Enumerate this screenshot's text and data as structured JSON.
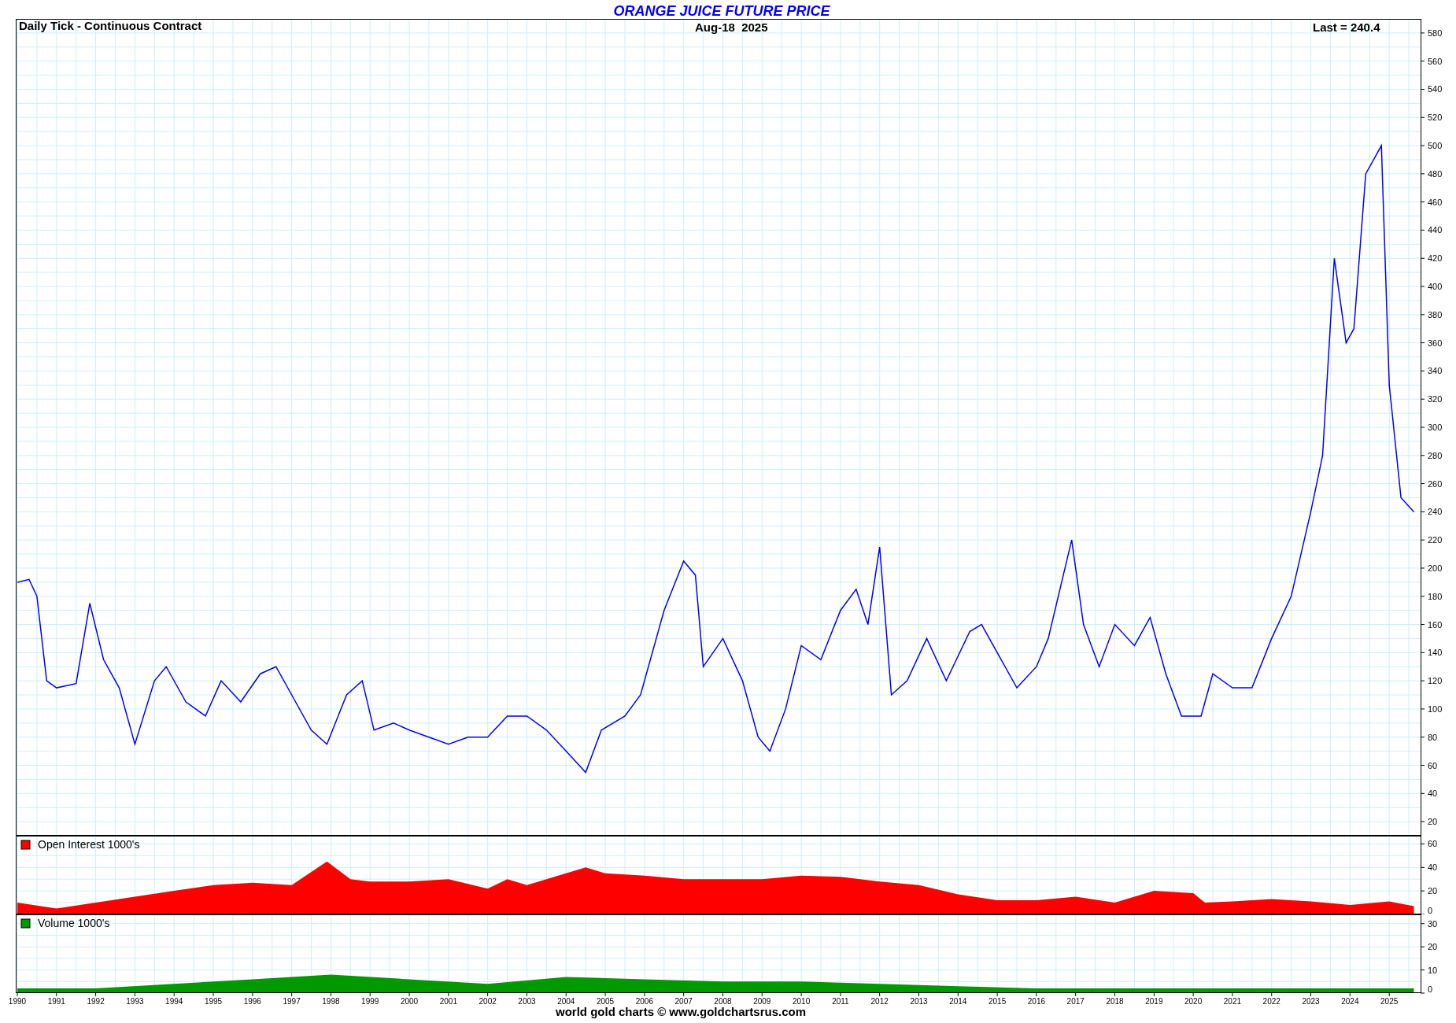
{
  "title": "ORANGE JUICE FUTURE PRICE",
  "price_panel": {
    "subtitle": "Daily Tick - Continuous Contract",
    "date": "Aug-18  2025",
    "last": "Last = 240.4",
    "chart_data": {
      "type": "line",
      "grid": true,
      "xlim": [
        1989.96,
        2025.8
      ],
      "ylim": [
        10,
        590
      ],
      "yticks": [
        20,
        40,
        60,
        80,
        100,
        120,
        140,
        160,
        180,
        200,
        220,
        240,
        260,
        280,
        300,
        320,
        340,
        360,
        380,
        400,
        420,
        440,
        460,
        480,
        500,
        520,
        540,
        560,
        580
      ],
      "x": [
        1990,
        1990.3,
        1990.5,
        1990.75,
        1991,
        1991.5,
        1991.85,
        1992.2,
        1992.6,
        1993,
        1993.5,
        1993.8,
        1994.3,
        1994.8,
        1995.2,
        1995.7,
        1996.2,
        1996.6,
        1997,
        1997.5,
        1997.9,
        1998.4,
        1998.8,
        1999.1,
        1999.6,
        2000,
        2000.5,
        2001,
        2001.5,
        2002,
        2002.5,
        2003,
        2003.5,
        2004,
        2004.5,
        2004.9,
        2005.5,
        2005.9,
        2006.5,
        2007,
        2007.3,
        2007.5,
        2008,
        2008.5,
        2008.9,
        2009.2,
        2009.6,
        2010,
        2010.5,
        2011,
        2011.4,
        2011.7,
        2012,
        2012.3,
        2012.7,
        2013.2,
        2013.7,
        2014.3,
        2014.6,
        2015,
        2015.5,
        2016,
        2016.3,
        2016.9,
        2017.2,
        2017.6,
        2018,
        2018.5,
        2018.9,
        2019.3,
        2019.7,
        2020.2,
        2020.5,
        2021,
        2021.5,
        2022,
        2022.5,
        2023,
        2023.3,
        2023.6,
        2023.9,
        2024.1,
        2024.4,
        2024.8,
        2025,
        2025.3,
        2025.63
      ],
      "series": [
        {
          "color": "#0000ff",
          "values": [
            190,
            192,
            180,
            120,
            115,
            118,
            175,
            135,
            115,
            75,
            120,
            130,
            105,
            95,
            120,
            105,
            125,
            130,
            110,
            85,
            75,
            110,
            120,
            85,
            90,
            85,
            80,
            75,
            80,
            80,
            95,
            95,
            85,
            70,
            55,
            85,
            95,
            110,
            170,
            205,
            195,
            130,
            150,
            120,
            80,
            70,
            100,
            145,
            135,
            170,
            185,
            160,
            215,
            110,
            120,
            150,
            120,
            155,
            160,
            140,
            115,
            130,
            150,
            220,
            160,
            130,
            160,
            145,
            165,
            125,
            95,
            95,
            125,
            115,
            115,
            150,
            180,
            240,
            280,
            420,
            360,
            370,
            480,
            500,
            330,
            250,
            240
          ]
        }
      ]
    }
  },
  "open_interest_panel": {
    "chart_data": {
      "type": "area",
      "grid": true,
      "xlim": [
        1989.96,
        2025.8
      ],
      "ylim": [
        0,
        67
      ],
      "yticks": [
        0,
        20,
        40,
        60
      ],
      "x": [
        1990,
        1991,
        1992,
        1993,
        1994,
        1995,
        1996,
        1997,
        1997.9,
        1998.5,
        1999,
        2000,
        2001,
        2002,
        2002.5,
        2003,
        2004.5,
        2005,
        2006,
        2007,
        2008,
        2009,
        2010,
        2011,
        2012,
        2013,
        2014,
        2015,
        2016,
        2017,
        2018,
        2019,
        2020,
        2020.3,
        2021,
        2022,
        2023,
        2024,
        2025,
        2025.63
      ],
      "series": [
        {
          "name": "Open Interest 1000's",
          "color": "#ff0000",
          "values": [
            10,
            5,
            10,
            15,
            20,
            25,
            27,
            25,
            45,
            30,
            28,
            28,
            30,
            22,
            30,
            25,
            40,
            35,
            33,
            30,
            30,
            30,
            33,
            32,
            28,
            25,
            17,
            12,
            12,
            15,
            10,
            20,
            18,
            10,
            11,
            13,
            11,
            8,
            11,
            7
          ]
        }
      ]
    }
  },
  "volume_panel": {
    "chart_data": {
      "type": "area",
      "grid": true,
      "xlim": [
        1989.96,
        2025.8
      ],
      "ylim": [
        0,
        34
      ],
      "yticks": [
        0,
        10,
        20,
        30
      ],
      "xticks": [
        1990,
        1991,
        1992,
        1993,
        1994,
        1995,
        1996,
        1997,
        1998,
        1999,
        2000,
        2001,
        2002,
        2003,
        2004,
        2005,
        2006,
        2007,
        2008,
        2009,
        2010,
        2011,
        2012,
        2013,
        2014,
        2015,
        2016,
        2017,
        2018,
        2019,
        2020,
        2021,
        2022,
        2023,
        2024,
        2025
      ],
      "x": [
        1990,
        1992,
        1994,
        1996,
        1998,
        2000,
        2002,
        2004,
        2006,
        2008,
        2010,
        2012,
        2014,
        2016,
        2018,
        2020,
        2022,
        2025.63
      ],
      "series": [
        {
          "name": "Volume 1000's",
          "color": "#009900",
          "values": [
            2,
            2,
            4,
            6,
            8,
            6,
            4,
            7,
            6,
            5,
            5,
            4,
            3,
            2,
            2,
            2,
            2,
            2
          ]
        }
      ]
    }
  },
  "footer": "world gold charts © www.goldchartsrus.com"
}
